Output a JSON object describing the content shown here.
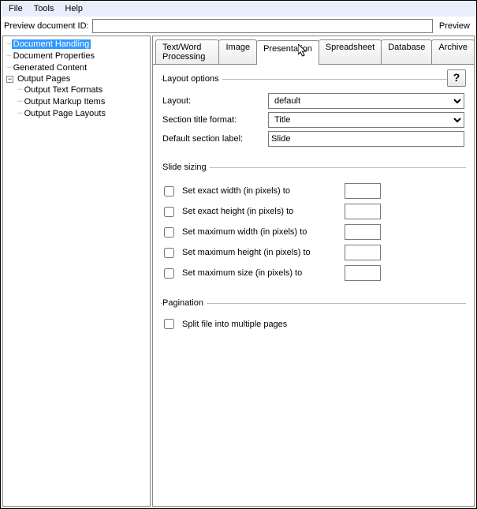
{
  "menu": {
    "file": "File",
    "tools": "Tools",
    "help": "Help"
  },
  "toolbar": {
    "preview_id_label": "Preview document ID:",
    "preview_id_value": "",
    "preview_button": "Preview"
  },
  "tree": {
    "doc_handling": "Document Handling",
    "doc_properties": "Document Properties",
    "generated_content": "Generated Content",
    "output_pages": "Output Pages",
    "output_text_formats": "Output Text Formats",
    "output_markup_items": "Output Markup Items",
    "output_page_layouts": "Output Page Layouts"
  },
  "tabs": {
    "text_wp": "Text/Word Processing",
    "image": "Image",
    "presentation": "Presentation",
    "spreadsheet": "Spreadsheet",
    "database": "Database",
    "archive": "Archive"
  },
  "panel": {
    "help": "?",
    "layout_options_legend": "Layout options",
    "layout_label": "Layout:",
    "layout_value": "default",
    "section_title_label": "Section title format:",
    "section_title_value": "Title",
    "default_section_label": "Default section label:",
    "default_section_value": "Slide",
    "slide_sizing_legend": "Slide sizing",
    "set_exact_width": "Set exact width (in pixels) to",
    "set_exact_height": "Set exact height (in pixels) to",
    "set_max_width": "Set maximum width (in pixels) to",
    "set_max_height": "Set maximum height (in pixels) to",
    "set_max_size": "Set maximum size (in pixels) to",
    "pagination_legend": "Pagination",
    "split_file": "Split file into multiple pages"
  }
}
